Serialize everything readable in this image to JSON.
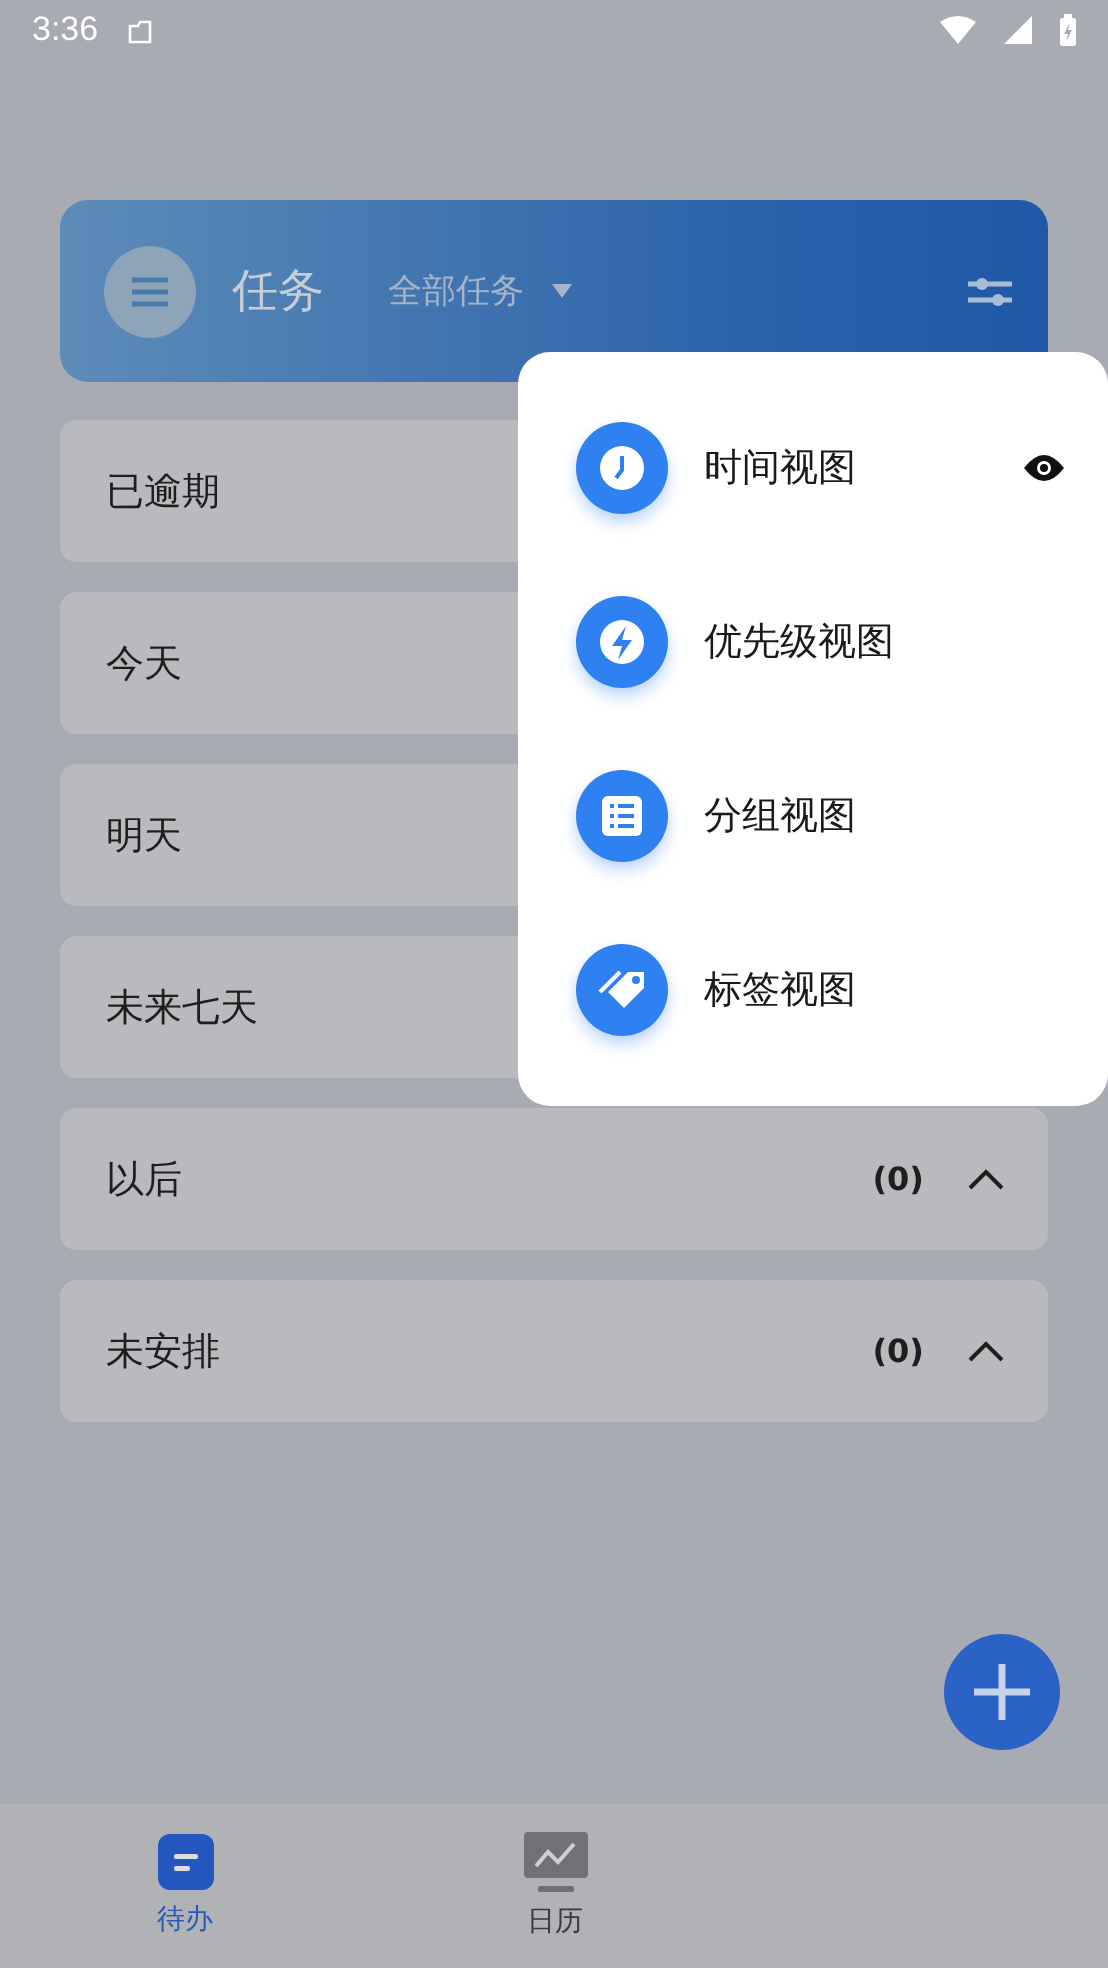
{
  "status_bar": {
    "time": "3:36"
  },
  "header": {
    "title": "任务",
    "filter": "全部任务"
  },
  "sections": [
    {
      "label": "已逾期"
    },
    {
      "label": "今天"
    },
    {
      "label": "明天"
    },
    {
      "label": "未来七天"
    },
    {
      "label": "以后",
      "count": "(0)",
      "expanded": true
    },
    {
      "label": "未安排",
      "count": "(0)",
      "expanded": true
    }
  ],
  "view_menu": [
    {
      "label": "时间视图",
      "kind": "clock",
      "selected": true
    },
    {
      "label": "优先级视图",
      "kind": "bolt",
      "selected": false
    },
    {
      "label": "分组视图",
      "kind": "list",
      "selected": false
    },
    {
      "label": "标签视图",
      "kind": "tag",
      "selected": false
    }
  ],
  "bottom_nav": [
    {
      "label": "待办",
      "kind": "todo",
      "selected": true
    },
    {
      "label": "日历",
      "kind": "chart",
      "selected": false
    }
  ]
}
